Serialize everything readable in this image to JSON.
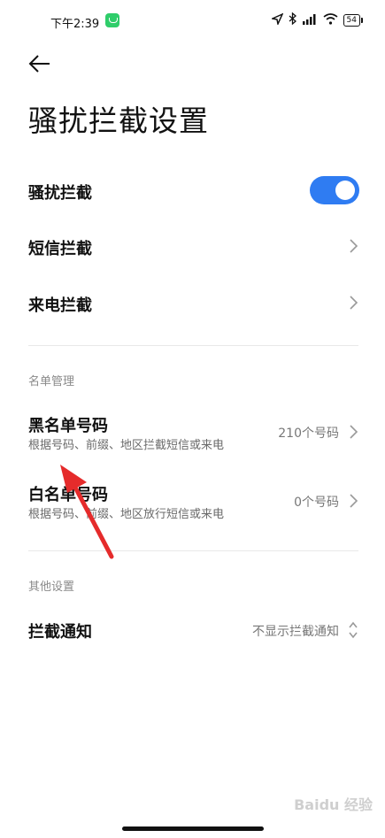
{
  "status": {
    "time": "下午2:39",
    "battery": "54"
  },
  "page": {
    "title": "骚扰拦截设置"
  },
  "settings": {
    "harassment": {
      "label": "骚扰拦截",
      "enabled": true
    },
    "sms": {
      "label": "短信拦截"
    },
    "call": {
      "label": "来电拦截"
    }
  },
  "list_section": {
    "header": "名单管理",
    "blacklist": {
      "label": "黑名单号码",
      "sub": "根据号码、前缀、地区拦截短信或来电",
      "value": "210个号码"
    },
    "whitelist": {
      "label": "白名单号码",
      "sub": "根据号码、前缀、地区放行短信或来电",
      "value": "0个号码"
    }
  },
  "other_section": {
    "header": "其他设置",
    "notify": {
      "label": "拦截通知",
      "value": "不显示拦截通知"
    }
  },
  "watermark": "Baidu 经验"
}
